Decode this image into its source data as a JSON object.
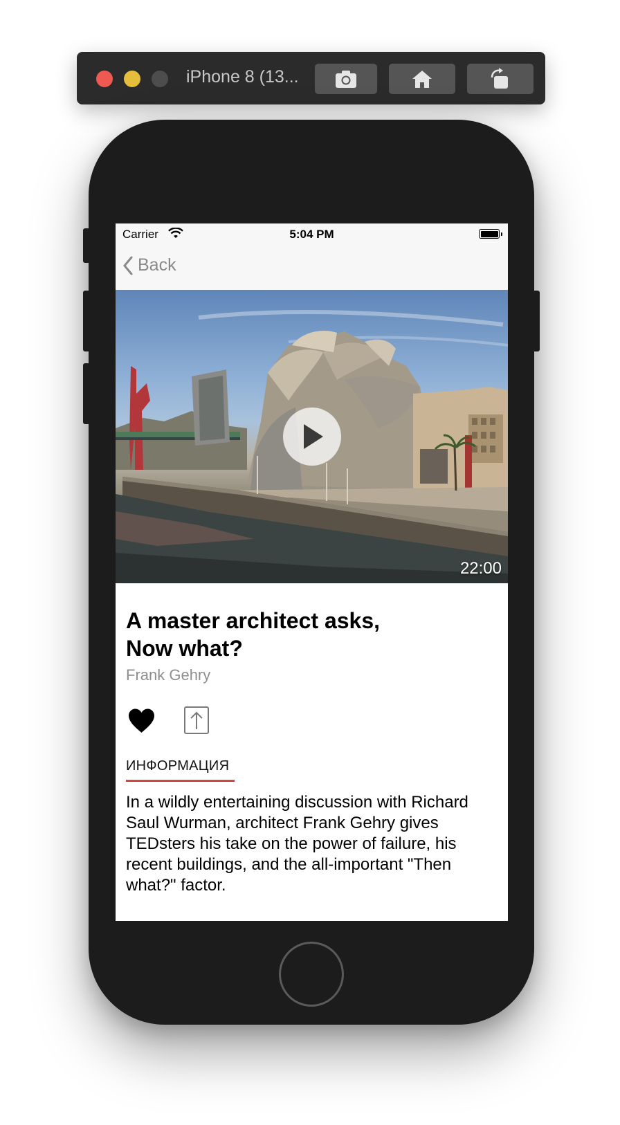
{
  "simulator": {
    "title": "iPhone 8 (13..."
  },
  "status_bar": {
    "carrier": "Carrier",
    "time": "5:04 PM"
  },
  "nav": {
    "back_label": "Back"
  },
  "video": {
    "duration": "22:00"
  },
  "talk": {
    "title_line1": "A master architect asks,",
    "title_line2": "Now what?",
    "speaker": "Frank Gehry"
  },
  "tabs": {
    "info_label": "ИНФОРМАЦИЯ"
  },
  "description": "In a wildly entertaining discussion with Richard Saul Wurman, architect Frank Gehry gives TEDsters his take on the power of failure, his recent buildings, and the all-important \"Then what?\" factor.",
  "colors": {
    "accent": "#d4453b",
    "secondary_text": "#8e8e8e"
  }
}
